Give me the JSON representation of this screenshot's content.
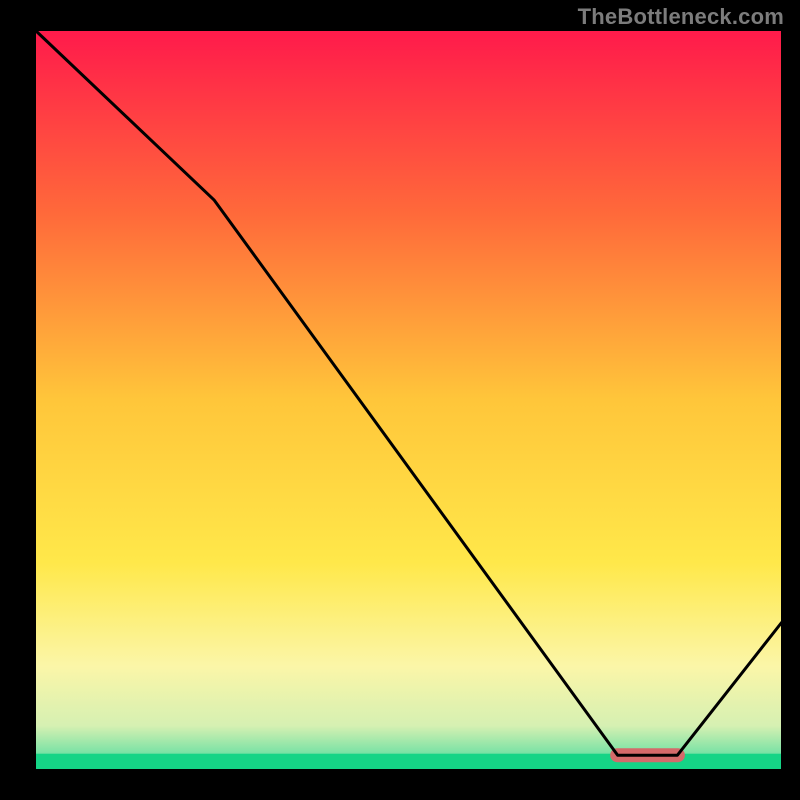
{
  "watermark": "TheBottleneck.com",
  "chart_data": {
    "type": "line",
    "title": "",
    "xlabel": "",
    "ylabel": "",
    "xlim": [
      0,
      100
    ],
    "ylim": [
      0,
      100
    ],
    "grid": false,
    "legend": false,
    "background_gradient": {
      "stops": [
        {
          "pos": 0.0,
          "color": "#ff1a4b"
        },
        {
          "pos": 0.25,
          "color": "#ff6a3a"
        },
        {
          "pos": 0.5,
          "color": "#ffc63a"
        },
        {
          "pos": 0.72,
          "color": "#ffe84a"
        },
        {
          "pos": 0.86,
          "color": "#fbf6a8"
        },
        {
          "pos": 0.94,
          "color": "#d6f0b2"
        },
        {
          "pos": 0.975,
          "color": "#7fe3a6"
        },
        {
          "pos": 1.0,
          "color": "#19d38a"
        }
      ]
    },
    "series": [
      {
        "name": "bottleneck-curve",
        "x": [
          0,
          24,
          78,
          86,
          100
        ],
        "y": [
          100,
          77,
          2,
          2,
          20
        ]
      }
    ],
    "marker": {
      "x_start": 77,
      "x_end": 87,
      "y": 2,
      "color": "#d46a6a"
    }
  }
}
